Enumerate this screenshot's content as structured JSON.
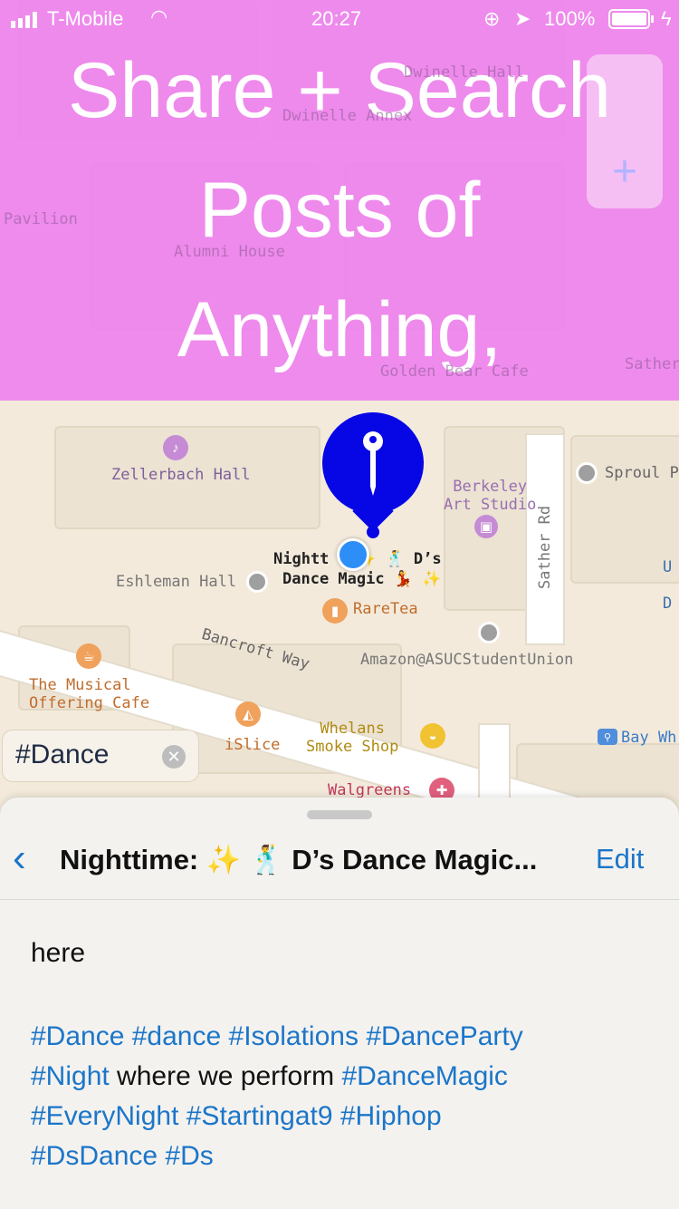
{
  "status_bar": {
    "carrier": "T-Mobile",
    "time": "20:27",
    "battery": "100%"
  },
  "overlay": {
    "line1": "Share + Search",
    "line2": "Posts of",
    "line3": "Anything,"
  },
  "map": {
    "labels_under_overlay": [
      "Dwinelle Hall",
      "Dwinelle Annex",
      "Pavilion",
      "Alumni House",
      "Golden Bear Cafe",
      "Sather"
    ],
    "labels": {
      "zellerbach": "Zellerbach Hall",
      "berkeley_art": "Berkeley\nArt Studio",
      "sproul": "Sproul P",
      "eshleman": "Eshleman Hall",
      "nighttime_pin": "Nightt  :  ✨ 🕺 D’s",
      "nighttime_pin2": "Dance Magic 💃 ✨",
      "raretea": "RareTea",
      "bancroft": "Bancroft Way",
      "amazon": "Amazon@ASUCStudentUnion",
      "musical": "The Musical\nOffering Cafe",
      "islice": "iSlice",
      "whelans": "Whelans\nSmoke Shop",
      "walgreens": "Walgreens",
      "bay": "Bay Wh",
      "sather_rd": "Sather Rd",
      "u": "U",
      "d": "D"
    },
    "search_chip": {
      "value": "#Dance"
    }
  },
  "sheet": {
    "title": "Nighttime: ✨ 🕺 D’s Dance Magic...",
    "edit": "Edit",
    "body_line1": "here",
    "tags1": [
      "#Dance",
      "#dance",
      "#Isolations",
      "#DanceParty"
    ],
    "line2_tag1": "#Night",
    "line2_text": " where we perform ",
    "line2_tag2": "#DanceMagic",
    "tags3": [
      "#EveryNight",
      "#Startingat9",
      "#Hiphop"
    ],
    "tags4": [
      "#DsDance",
      "#Ds"
    ]
  },
  "colors": {
    "overlay": "#ee82ee",
    "pin": "#0707e6",
    "link": "#1b76c9",
    "user_location": "#2d8ef7"
  }
}
